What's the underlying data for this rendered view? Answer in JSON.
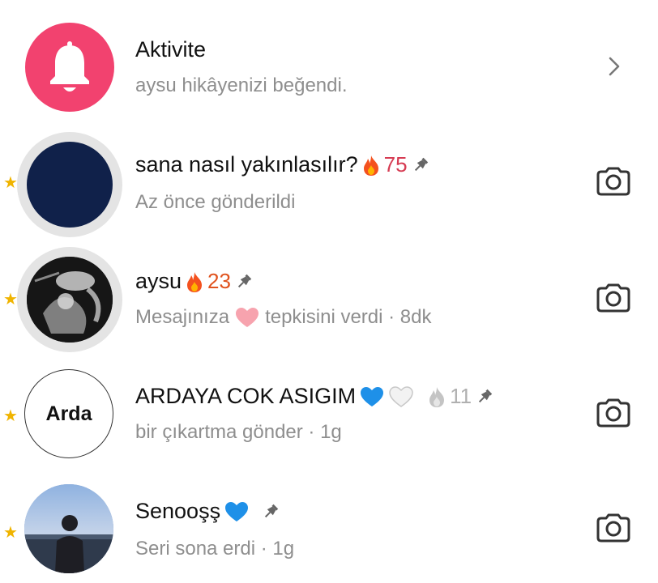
{
  "activity": {
    "title": "Aktivite",
    "subtitle": "aysu hikâyenizi beğendi."
  },
  "chats": [
    {
      "name": "sana nasıl yakınlasılır?",
      "streak_count": "75",
      "streak_color": "#d63b52",
      "subtitle": "Az önce gönderildi",
      "subtitle_heart": false,
      "pinned": true
    },
    {
      "name": "aysu",
      "streak_count": "23",
      "streak_color": "#e0531e",
      "subtitle_before": "Mesajınıza",
      "subtitle_after": "tepkisini verdi · 8dk",
      "subtitle_heart": true,
      "pinned": true
    },
    {
      "name": "ARDAYA COK ASIGIM",
      "streak_count": "11",
      "streak_color": "#b0b0b0",
      "subtitle": "bir çıkartma gönder · 1g",
      "avatar_text": "Arda",
      "pinned": true
    },
    {
      "name": "Senooşş",
      "subtitle": "Seri sona erdi · 1g",
      "pinned": true
    }
  ],
  "colors": {
    "activity_pink": "#f2426f",
    "star": "#f0b400",
    "heart_blue": "#1e90e8",
    "subtitle_gray": "#8e8e8e"
  }
}
